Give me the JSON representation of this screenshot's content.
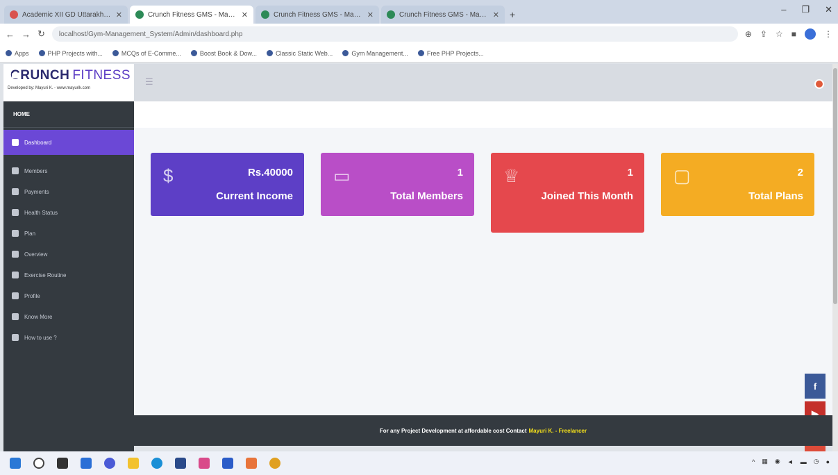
{
  "browser": {
    "tabs": [
      {
        "label": "Academic XII GD Uttarakhand",
        "active": false
      },
      {
        "label": "Crunch Fitness GMS - Mayuri K",
        "active": true
      },
      {
        "label": "Crunch Fitness GMS - Mayuri K",
        "active": false
      },
      {
        "label": "Crunch Fitness GMS - Mayuri K",
        "active": false
      }
    ],
    "url": "localhost/Gym-Management_System/Admin/dashboard.php",
    "bookmarks": [
      "Apps",
      "PHP Projects with...",
      "MCQs of E-Comme...",
      "Boost Book & Dow...",
      "Classic Static Web...",
      "Gym Management...",
      "Free PHP Projects..."
    ]
  },
  "app": {
    "logo_main": "CRUNCH",
    "logo_accent": "FITNESS",
    "logo_sub": "Developed by: Mayuri K. - www.mayurik.com",
    "nav_header": "HOME",
    "nav_items": [
      {
        "label": "Dashboard",
        "active": true
      },
      {
        "label": "Members"
      },
      {
        "label": "Payments"
      },
      {
        "label": "Health Status"
      },
      {
        "label": "Plan"
      },
      {
        "label": "Overview"
      },
      {
        "label": "Exercise Routine"
      },
      {
        "label": "Profile"
      },
      {
        "label": "Know More"
      },
      {
        "label": "How to use ?"
      }
    ]
  },
  "cards": [
    {
      "value": "Rs.40000",
      "label": "Current Income",
      "icon": "dollar-icon",
      "color": "#5d3fc6"
    },
    {
      "value": "1",
      "label": "Total Members",
      "icon": "id-card-icon",
      "color": "#b94ec7"
    },
    {
      "value": "1",
      "label": "Joined This Month",
      "icon": "crown-icon",
      "color": "#e5484d"
    },
    {
      "value": "2",
      "label": "Total Plans",
      "icon": "calendar-icon",
      "color": "#f4ac23"
    }
  ],
  "footer": {
    "text": "For any Project Development at affordable cost Contact",
    "highlight": "Mayuri K. - Freelancer"
  }
}
